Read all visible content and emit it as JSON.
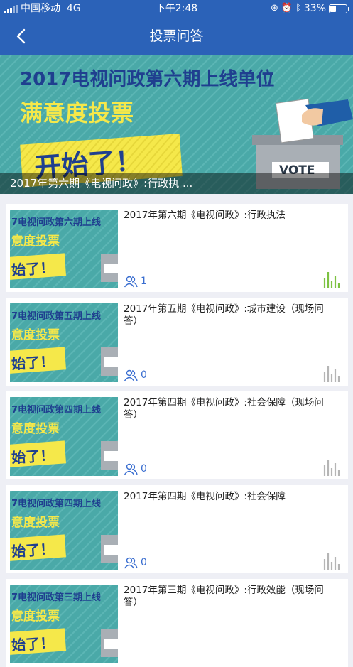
{
  "status_bar": {
    "carrier": "中国移动",
    "network": "4G",
    "time": "下午2:48",
    "battery": "33%"
  },
  "nav": {
    "title": "投票问答"
  },
  "banner": {
    "line1": "2017电视问政第六期上线单位",
    "line2": "满意度投票",
    "line3": "开始了！",
    "vote_text": "VOTE",
    "caption": "2017年第六期《电视问政》:行政执 ..."
  },
  "items": [
    {
      "title": "2017年第六期《电视问政》:行政执法",
      "count": "1",
      "active": true,
      "thumb": {
        "line1": "7电视问政第六期上线",
        "line2": "意度投票",
        "line3": "始了！"
      }
    },
    {
      "title": "2017年第五期《电视问政》:城市建设（现场问答）",
      "count": "0",
      "active": false,
      "thumb": {
        "line1": "7电视问政第五期上线",
        "line2": "意度投票",
        "line3": "始了！"
      }
    },
    {
      "title": "2017年第四期《电视问政》:社会保障（现场问答）",
      "count": "0",
      "active": false,
      "thumb": {
        "line1": "7电视问政第四期上线",
        "line2": "意度投票",
        "line3": "始了！"
      }
    },
    {
      "title": "2017年第四期《电视问政》:社会保障",
      "count": "0",
      "active": false,
      "thumb": {
        "line1": "7电视问政第四期上线",
        "line2": "意度投票",
        "line3": "始了！"
      }
    },
    {
      "title": "2017年第三期《电视问政》:行政效能（现场问答）",
      "count": "",
      "active": false,
      "thumb": {
        "line1": "7电视问政第三期上线",
        "line2": "意度投票",
        "line3": "始了！"
      }
    }
  ],
  "colors": {
    "nav_bg": "#2b62b8",
    "teal": "#4aa9a8",
    "yellow": "#f5e84a",
    "active_chart": "#7dc242",
    "inactive_chart": "#b5b5b5",
    "count_blue": "#3a6ed0"
  },
  "icons": {
    "back": "chevron-left-icon",
    "count": "users-icon",
    "chart": "bar-chart-icon"
  }
}
